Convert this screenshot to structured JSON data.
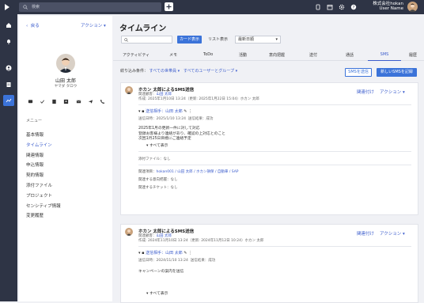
{
  "topbar": {
    "search_placeholder": "検索",
    "company": "株式会社hokan",
    "user": "User Name"
  },
  "sidebar": {
    "back": "戻る",
    "actions": "アクション",
    "name": "山田 太郎",
    "kana": "ヤマダ タロウ",
    "menu_heading": "メニュー",
    "menu": [
      "基本情報",
      "タイムライン",
      "関連情報",
      "申込情報",
      "契約情報",
      "添付ファイル",
      "プロジェクト",
      "センシティブ情報",
      "変更履歴"
    ]
  },
  "main": {
    "title": "タイムライン",
    "view_card": "カード表示",
    "view_list": "リスト表示",
    "sort": "最新日順",
    "tabs": [
      "アクティビティ",
      "メモ",
      "ToDo",
      "活動",
      "意向把握",
      "送付",
      "通話",
      "SMS",
      "履歴"
    ],
    "filter_label": "絞り込み条件：",
    "filter_all_types": "すべての世帯員",
    "filter_all_users": "すべてのユーザーとグループ",
    "sms_send": "SMSを送信",
    "new_sms": "新しいSMSを記録"
  },
  "cards": [
    {
      "title": "ホカン 太郎によるSMS送信",
      "related_label": "関連顧客：",
      "related": "山田 太郎",
      "created": "作成: 2025年1月10日 13:24（更新: 2025年1月22日 15:04）ホカン 太郎",
      "link": "関連付け",
      "action": "アクション",
      "recipient_label": "送信相手：",
      "recipient": "山田 太郎",
      "sent_label": "送信日時：",
      "sent": "2025/1/10 13:24",
      "result_label": "送信結果：",
      "result": "成功",
      "body": [
        "2025年1月の更新一件に対して対応",
        "登録お客様より連絡があり、確認の上対応とのこと",
        "次回1月25日目標にご連絡予定"
      ],
      "show_all": "すべて表示",
      "attach": "添付ファイル：なし",
      "related_items_label": "関連項目：",
      "related_items": "hokan001 / 山田 太郎 / ホカン損保 / 自動車 / SAP",
      "related_intent": "関連する意向把握：なし",
      "related_ticket": "関連するチケット：なし"
    },
    {
      "title": "ホカン 太郎によるSMS送信",
      "related_label": "関連顧客：",
      "related": "山田 太郎",
      "created": "作成: 2024年11月10日 13:24（更新: 2024年11月12日 10:24）ホカン 太郎",
      "link": "関連付け",
      "action": "アクション",
      "recipient_label": "送信相手：",
      "recipient": "山田 太郎",
      "sent_label": "送信日時：",
      "sent": "2024/11/10 13:24",
      "result_label": "送信結果：",
      "result": "成功",
      "body": [
        "キャンペーンの案内を送信"
      ],
      "show_all": "すべて表示"
    }
  ],
  "colors": {
    "accent": "#3b73d9",
    "topbar": "#2e3445"
  }
}
